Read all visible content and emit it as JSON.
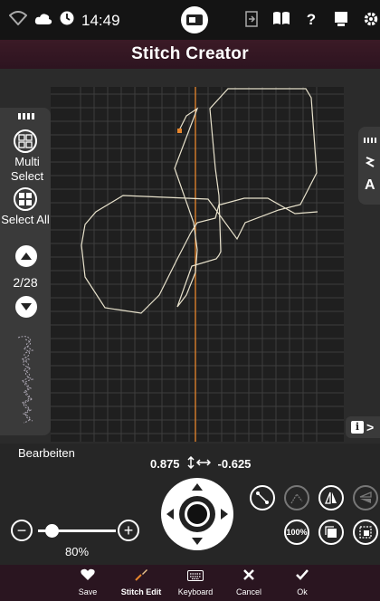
{
  "status_bar": {
    "time": "14:49",
    "icons": [
      "wifi-icon",
      "cloud-icon",
      "clock-icon",
      "machine-icon",
      "import-icon",
      "book-icon",
      "help-icon",
      "tablet-icon",
      "gear-icon"
    ]
  },
  "header": {
    "title": "Stitch Creator"
  },
  "left_panel": {
    "multi_select_label": "Multi Select",
    "select_all_label": "Select All",
    "page_indicator": "2/28"
  },
  "right_panel": {
    "text_tool_label": "A"
  },
  "edit": {
    "section_label": "Bearbeiten",
    "x_value": "0.875",
    "y_value": "-0.625"
  },
  "tools": {
    "percent_label": "100%"
  },
  "zoom": {
    "level": "80%",
    "value": 0.8
  },
  "bottom_bar": {
    "items": [
      {
        "label": "Save",
        "icon": "heart-icon"
      },
      {
        "label": "Stitch Edit",
        "icon": "stitch-edit-icon"
      },
      {
        "label": "Keyboard",
        "icon": "keyboard-icon"
      },
      {
        "label": "Cancel",
        "icon": "close-icon"
      },
      {
        "label": "Ok",
        "icon": "check-icon"
      }
    ]
  },
  "colors": {
    "accent": "#e8862c",
    "title_bar": "#3b1a26",
    "bottom_bar": "#2a1520"
  }
}
